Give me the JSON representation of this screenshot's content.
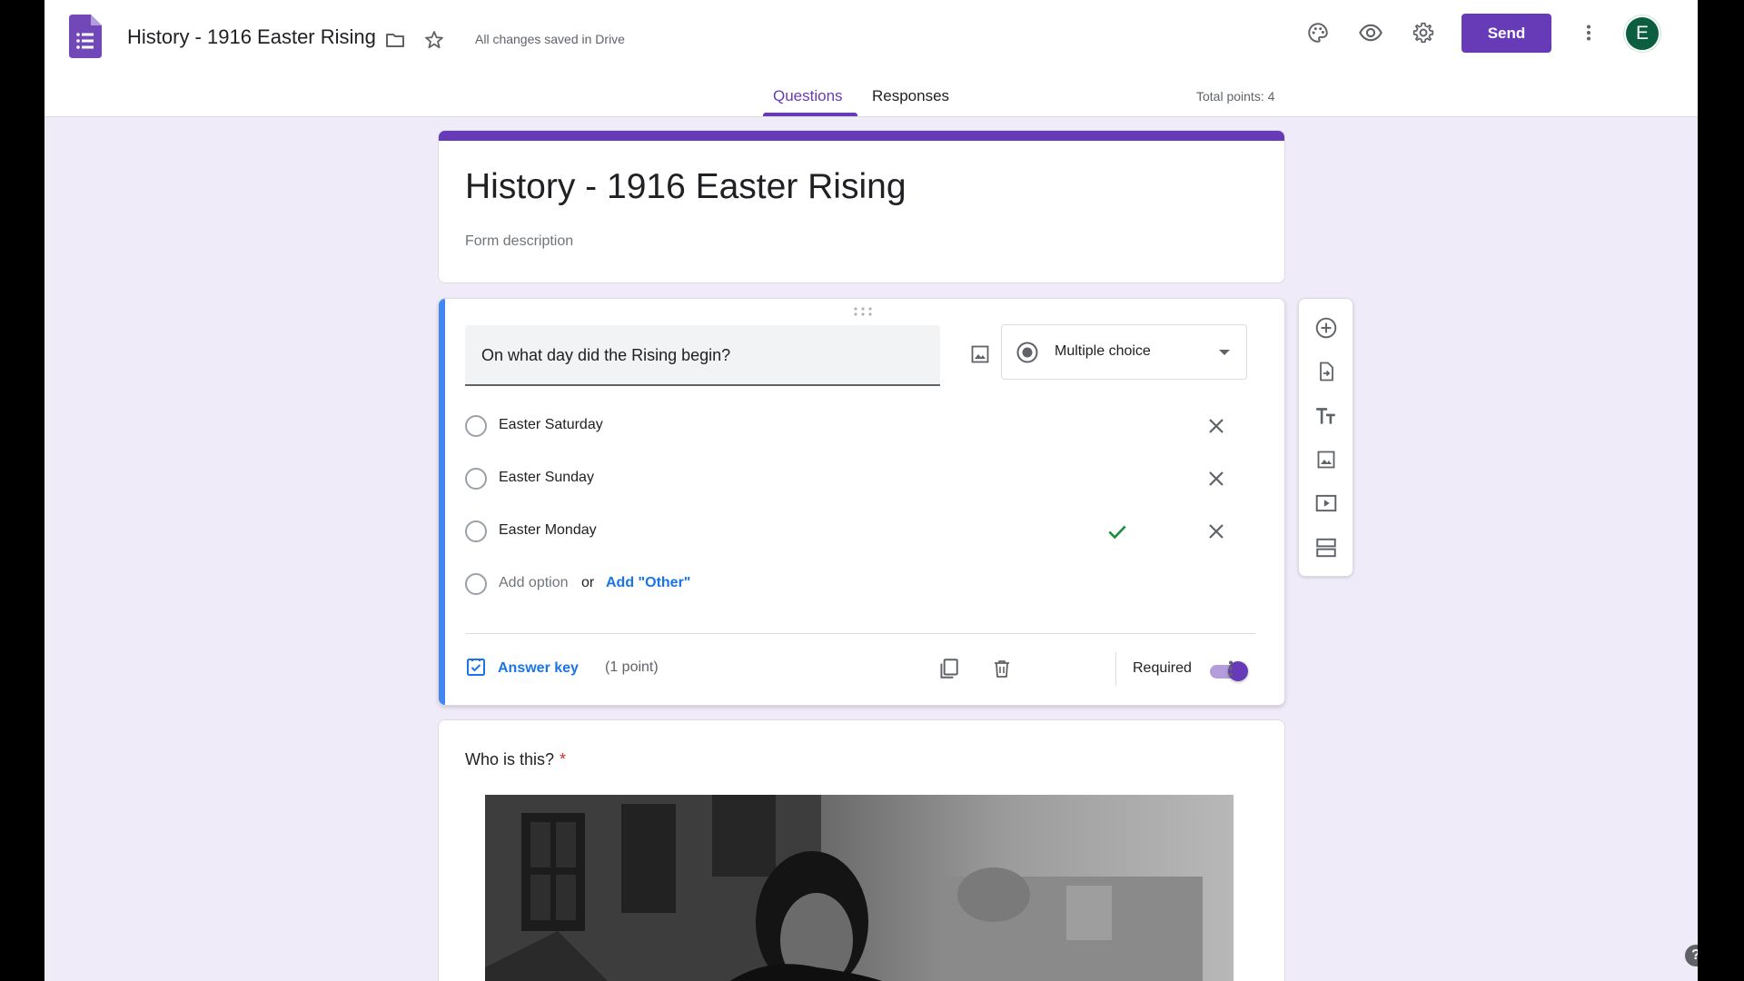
{
  "header": {
    "doc_title": "History - 1916 Easter Rising",
    "save_status": "All changes saved in Drive",
    "send_label": "Send",
    "avatar_initial": "E",
    "icons": [
      "forms-logo-icon",
      "folder-icon",
      "star-icon",
      "palette-icon",
      "eye-icon",
      "gear-icon",
      "more-vert-icon"
    ]
  },
  "tabs": {
    "questions": "Questions",
    "responses": "Responses",
    "active": "Questions"
  },
  "total_points": "Total points: 4",
  "form": {
    "title": "History - 1916 Easter Rising",
    "description_placeholder": "Form description"
  },
  "question1": {
    "text": "On what day did the Rising begin?",
    "type": "Multiple choice",
    "options": [
      {
        "label": "Easter Saturday",
        "correct": false
      },
      {
        "label": "Easter Sunday",
        "correct": false
      },
      {
        "label": "Easter Monday",
        "correct": true
      }
    ],
    "add_option": "Add option",
    "or": "or",
    "add_other": "Add \"Other\"",
    "answer_key": "Answer key",
    "points": "(1 point)",
    "required_label": "Required",
    "required": true
  },
  "side_toolbar": [
    "add-question-icon",
    "import-questions-icon",
    "add-title-icon",
    "add-image-icon",
    "add-video-icon",
    "add-section-icon"
  ],
  "question2": {
    "text": "Who is this?",
    "required_mark": "*"
  },
  "colors": {
    "accent": "#673ab7",
    "background": "#f0ebf8",
    "link": "#1a73e8",
    "focus": "#4285f4",
    "correct": "#1e8e3e"
  }
}
